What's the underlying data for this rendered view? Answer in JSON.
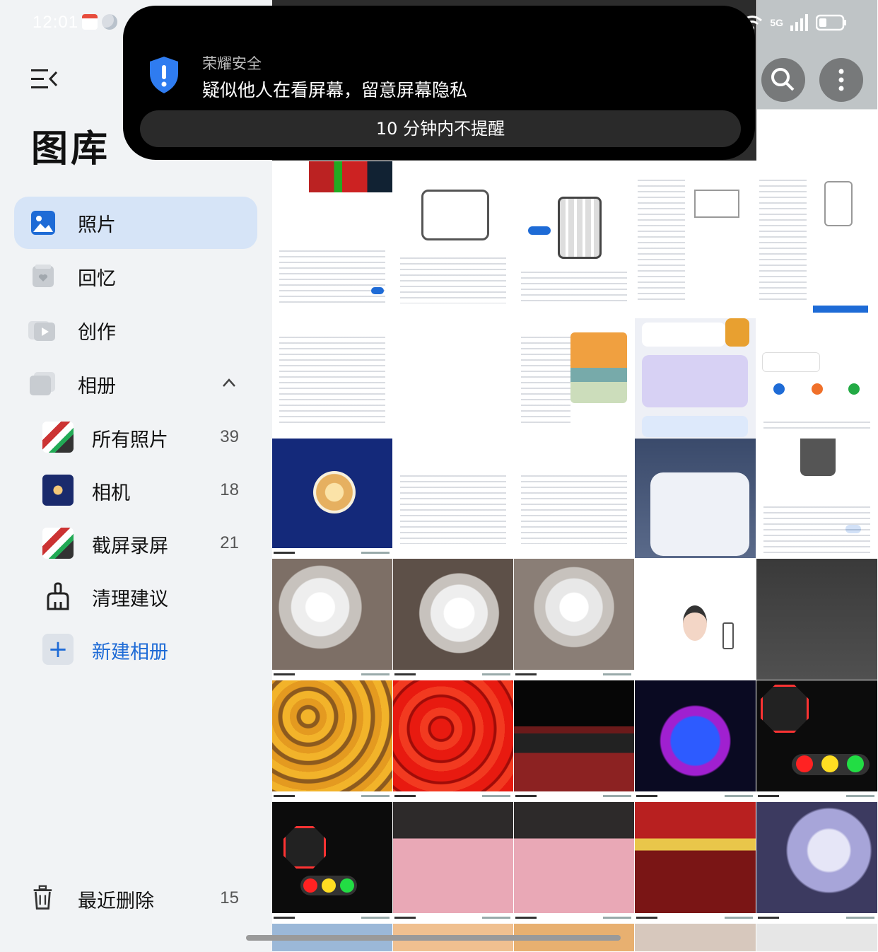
{
  "status": {
    "time": "12:01",
    "network": "5G"
  },
  "sidebar": {
    "title": "图库",
    "nav": [
      {
        "label": "照片"
      },
      {
        "label": "回忆"
      },
      {
        "label": "创作"
      },
      {
        "label": "相册"
      }
    ],
    "albums": [
      {
        "label": "所有照片",
        "count": "39"
      },
      {
        "label": "相机",
        "count": "18"
      },
      {
        "label": "截屏录屏",
        "count": "21"
      },
      {
        "label": "清理建议",
        "count": ""
      },
      {
        "label": "新建相册",
        "count": ""
      }
    ],
    "recently_deleted": {
      "label": "最近删除",
      "count": "15"
    }
  },
  "notification": {
    "app": "荣耀安全",
    "message": "疑似他人在看屏幕，留意屏幕隐私",
    "action": "10 分钟内不提醒"
  },
  "colors": {
    "accent": "#1e6bd6",
    "active_bg": "#d6e4f7"
  }
}
